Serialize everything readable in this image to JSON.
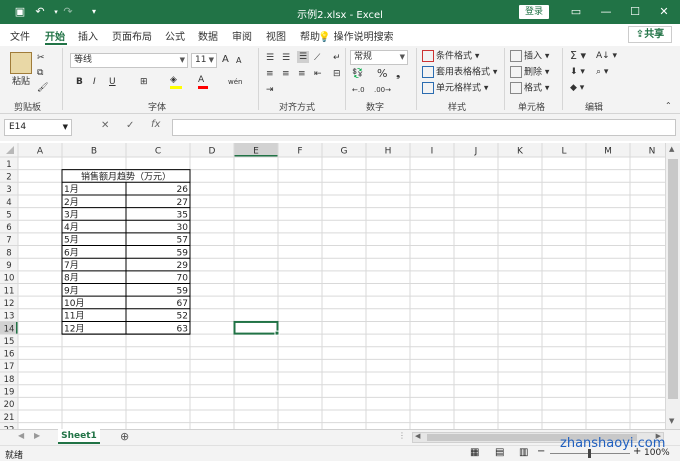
{
  "window": {
    "title": "示例2.xlsx  -  Excel",
    "login_label": "登录",
    "min": "—",
    "max": "☐",
    "close": "✕"
  },
  "qat": {
    "save_icon": "save-icon",
    "undo_icon": "undo-icon",
    "redo_icon": "redo-icon",
    "customize_icon": "customize-qat-icon"
  },
  "tabs": [
    {
      "label": "文件"
    },
    {
      "label": "开始"
    },
    {
      "label": "插入"
    },
    {
      "label": "页面布局"
    },
    {
      "label": "公式"
    },
    {
      "label": "数据"
    },
    {
      "label": "审阅"
    },
    {
      "label": "视图"
    },
    {
      "label": "帮助"
    }
  ],
  "tellme": "操作说明搜索",
  "share_label": "共享",
  "ribbon": {
    "clipboard": {
      "paste": "粘贴",
      "label": "剪贴板"
    },
    "font": {
      "name": "等线",
      "size": "11",
      "label": "字体",
      "bold": "B",
      "italic": "I",
      "underline": "U",
      "grow": "A",
      "shrink": "A"
    },
    "align": {
      "label": "对齐方式"
    },
    "number": {
      "format": "常规",
      "label": "数字"
    },
    "styles": {
      "cond": "条件格式",
      "table": "套用表格格式",
      "cell": "单元格样式",
      "label": "样式"
    },
    "cells": {
      "insert": "插入",
      "delete": "删除",
      "format": "格式",
      "label": "单元格"
    },
    "editing": {
      "label": "编辑"
    }
  },
  "formula_bar": {
    "name_box": "E14",
    "cancel": "✕",
    "enter": "✓",
    "fx": "fx",
    "formula": ""
  },
  "grid": {
    "columns": [
      "A",
      "B",
      "C",
      "D",
      "E",
      "F",
      "G",
      "H",
      "I",
      "J",
      "K",
      "L",
      "M",
      "N"
    ],
    "rows": [
      "1",
      "2",
      "3",
      "4",
      "5",
      "6",
      "7",
      "8",
      "9",
      "10",
      "11",
      "12",
      "13",
      "14",
      "15",
      "16",
      "17",
      "18",
      "19",
      "20",
      "21",
      "22",
      "23"
    ],
    "active_col": "E",
    "active_row": "14"
  },
  "table": {
    "header": "销售额月趋势（万元）",
    "rows": [
      {
        "month": "1月",
        "value": "26"
      },
      {
        "month": "2月",
        "value": "27"
      },
      {
        "month": "3月",
        "value": "35"
      },
      {
        "month": "4月",
        "value": "30"
      },
      {
        "month": "5月",
        "value": "57"
      },
      {
        "month": "6月",
        "value": "59"
      },
      {
        "month": "7月",
        "value": "29"
      },
      {
        "month": "8月",
        "value": "70"
      },
      {
        "month": "9月",
        "value": "59"
      },
      {
        "month": "10月",
        "value": "67"
      },
      {
        "month": "11月",
        "value": "52"
      },
      {
        "month": "12月",
        "value": "63"
      }
    ]
  },
  "sheets": [
    {
      "name": "Sheet1"
    }
  ],
  "status": {
    "text": "就绪",
    "zoom": "100%"
  },
  "watermark": "zhanshaoyi.com",
  "colors": {
    "accent": "#217346"
  }
}
